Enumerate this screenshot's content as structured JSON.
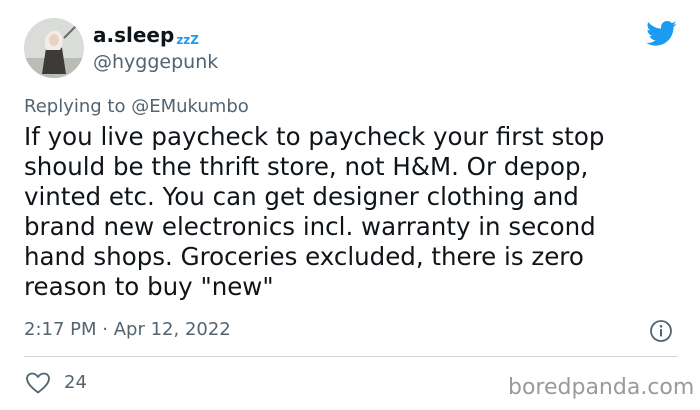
{
  "author": {
    "display_name": "a.sleep",
    "name_decoration": "zzZ",
    "handle": "@hyggepunk"
  },
  "reply": {
    "prefix": "Replying to",
    "to": "@EMukumbo"
  },
  "tweet": {
    "text": "If you live paycheck to paycheck your first stop\nshould be the thrift store, not H&M. Or depop,\nvinted etc. You can get designer clothing and\nbrand new electronics incl. warranty in second\nhand shops. Groceries excluded, there is zero\nreason to buy \"new\"",
    "time": "2:17 PM",
    "separator": "·",
    "date": "Apr 12, 2022",
    "likes": "24"
  },
  "icons": {
    "logo": "twitter-bird-icon",
    "info": "info-icon",
    "like": "heart-icon"
  },
  "colors": {
    "brand": "#1d9bf0",
    "text": "#0f1419",
    "muted": "#536471",
    "divider": "#cfd9de",
    "watermark": "#9a9a9a"
  },
  "watermark": "boredpanda.com"
}
